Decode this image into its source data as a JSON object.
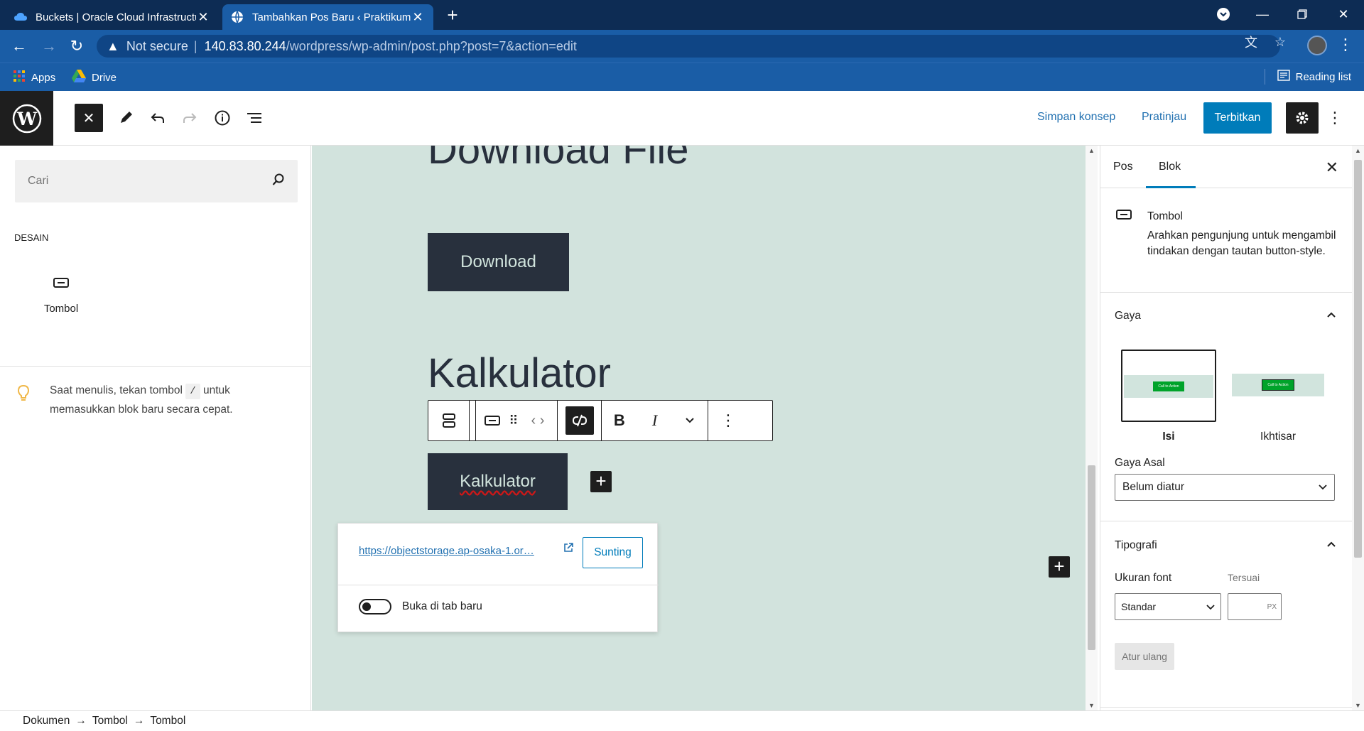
{
  "browser": {
    "tabs": [
      {
        "title": "Buckets | Oracle Cloud Infrastructure",
        "close": "✕"
      },
      {
        "title": "Tambahkan Pos Baru ‹ Praktikum",
        "close": "✕"
      }
    ],
    "not_secure": "Not secure",
    "url_host": "140.83.80.244",
    "url_rest": "/wordpress/wp-admin/post.php?post=7&action=edit",
    "bookmarks": [
      {
        "label": "Apps"
      },
      {
        "label": "Drive"
      }
    ],
    "reading_list": "Reading list"
  },
  "wp_header": {
    "save_draft": "Simpan konsep",
    "preview": "Pratinjau",
    "publish": "Terbitkan"
  },
  "inserter": {
    "search_placeholder": "Cari",
    "category": "DESAIN",
    "block_label": "Tombol",
    "tip_before": "Saat menulis, tekan tombol",
    "tip_key": "/",
    "tip_after": "untuk memasukkan blok baru secara cepat."
  },
  "canvas": {
    "heading_1": "Download File",
    "button_1": "Download",
    "heading_2": "Kalkulator",
    "button_2": "Kalkulator",
    "link_url": "https://objectstorage.ap-osaka-1.or…",
    "edit_link": "Sunting",
    "open_new_tab": "Buka di tab baru"
  },
  "sidebar": {
    "tab_post": "Pos",
    "tab_block": "Blok",
    "block_title": "Tombol",
    "block_desc": "Arahkan pengunjung untuk mengambil tindakan dengan tautan button-style.",
    "styles_heading": "Gaya",
    "style_fill": "Isi",
    "style_outline": "Ikhtisar",
    "style_preview_text": "Call to Action",
    "default_style_label": "Gaya Asal",
    "default_style_value": "Belum diatur",
    "typography_heading": "Tipografi",
    "font_size_label": "Ukuran font",
    "custom_label": "Tersuai",
    "font_size_value": "Standar",
    "custom_unit": "PX",
    "reset": "Atur ulang"
  },
  "footer": {
    "breadcrumbs": [
      "Dokumen",
      "Tombol",
      "Tombol"
    ],
    "sep": "→"
  },
  "colors": {
    "chrome_tabbar": "#0d2c54",
    "chrome_toolbar": "#1a5da6",
    "canvas_bg": "#d2e3dd",
    "button_bg": "#28303d",
    "wp_accent": "#007cba"
  }
}
